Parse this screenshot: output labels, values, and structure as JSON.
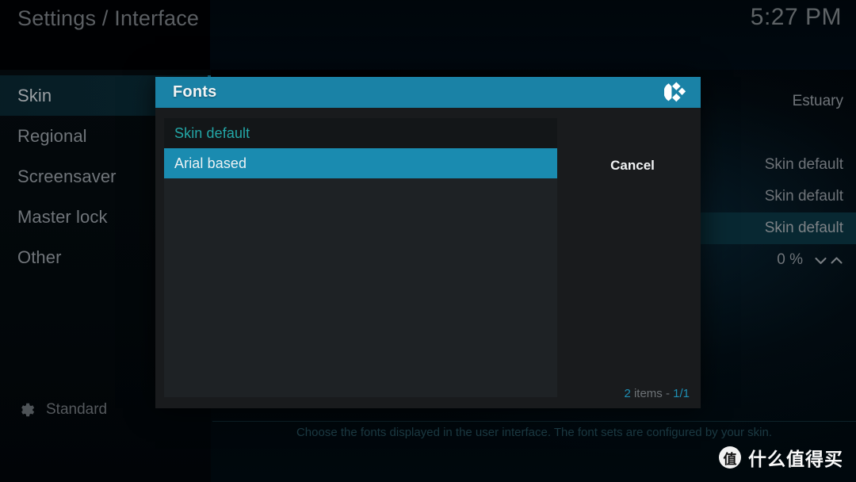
{
  "topbar": {
    "breadcrumb": "Settings / Interface",
    "clock": "5:27 PM"
  },
  "sidebar": {
    "items": [
      {
        "label": "Skin",
        "selected": true
      },
      {
        "label": "Regional",
        "selected": false
      },
      {
        "label": "Screensaver",
        "selected": false
      },
      {
        "label": "Master lock",
        "selected": false
      },
      {
        "label": "Other",
        "selected": false
      }
    ],
    "profile_level": "Standard",
    "gear_icon": "gear-icon"
  },
  "settings_values": [
    {
      "value": "Estuary",
      "focused": false,
      "spinner": false
    },
    {
      "value": "",
      "focused": false,
      "spinner": false
    },
    {
      "value": "Skin default",
      "focused": false,
      "spinner": false
    },
    {
      "value": "Skin default",
      "focused": false,
      "spinner": false
    },
    {
      "value": "Skin default",
      "focused": true,
      "spinner": false
    },
    {
      "value": "0 %",
      "focused": false,
      "spinner": true
    }
  ],
  "help_text": "Choose the fonts displayed in the user interface. The font sets are configured by your skin.",
  "dialog": {
    "title": "Fonts",
    "logo_icon": "kodi-logo-icon",
    "cancel_label": "Cancel",
    "options": [
      {
        "label": "Skin default",
        "state": "current"
      },
      {
        "label": "Arial based",
        "state": "highlight"
      }
    ],
    "footer": {
      "count": "2",
      "count_label": " items - ",
      "page": "1/1"
    }
  },
  "watermark": {
    "badge": "值",
    "text": "什么值得买"
  },
  "colors": {
    "accent_teal": "#1a8bb0",
    "current_teal": "#23a7a7",
    "focus_bg": "#082832",
    "dialog_bg": "#191b1d",
    "list_bg": "#1e2225"
  }
}
